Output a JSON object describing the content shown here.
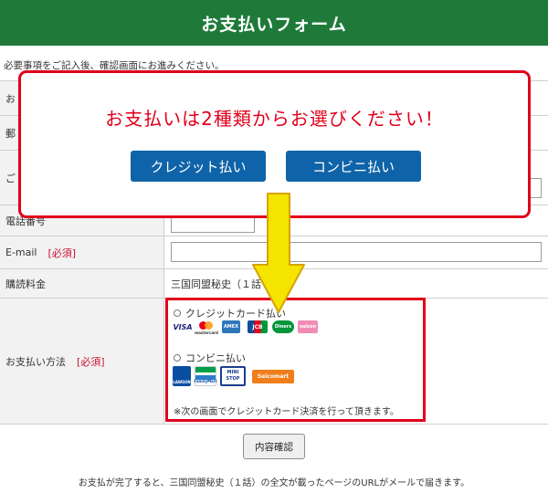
{
  "header": {
    "title": "お支払いフォーム"
  },
  "intro": "必要事項をご記入後、確認画面にお進みください。",
  "rows": {
    "r1": {
      "label": "お"
    },
    "r2": {
      "label": "郵"
    },
    "r3": {
      "label": "ご"
    },
    "phone": {
      "label": "電話番号"
    },
    "email": {
      "label": "E-mail",
      "required": "[必須]"
    },
    "price": {
      "label": "購読料金",
      "value": "三国同盟秘史（１話"
    },
    "payment": {
      "label": "お支払い方法",
      "required": "[必須]"
    }
  },
  "payment": {
    "credit": {
      "label": "クレジットカード払い",
      "logos": [
        "VISA",
        "mastercard",
        "AMEX",
        "JCB",
        "Diners",
        "saison"
      ]
    },
    "convenience": {
      "label": "コンビニ払い",
      "logos": [
        "LAWSON",
        "FamilyMart",
        "MINI STOP",
        "Seicomart"
      ]
    },
    "note": "※次の画面でクレジットカード決済を行って頂きます。"
  },
  "confirm_button": "内容確認",
  "footer": "お支払が完了すると、三国同盟秘史（１話）の全文が載ったページのURLがメールで届きます。",
  "popup": {
    "message": "お支払いは2種類からお選びください！",
    "credit_button": "クレジット払い",
    "convenience_button": "コンビニ払い"
  },
  "colors": {
    "header": "#1f7a3a",
    "alert": "#e0001b",
    "button": "#0f63a8",
    "arrow": "#f5e400"
  }
}
